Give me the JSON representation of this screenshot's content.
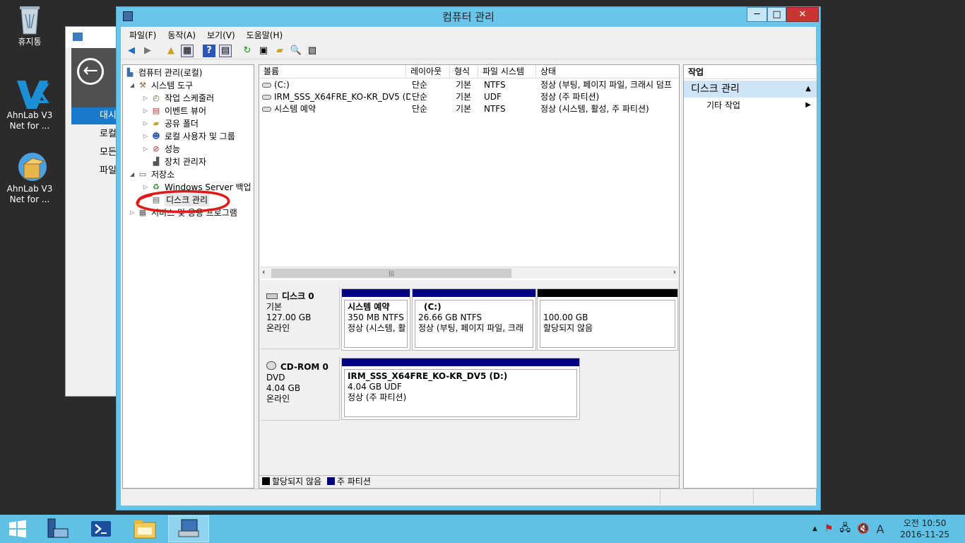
{
  "desktop": {
    "icons": [
      {
        "label": "휴지통"
      },
      {
        "label": "AhnLab V3 Net for ..."
      },
      {
        "label": "AhnLab V3 Net for ..."
      }
    ]
  },
  "background_window": {
    "nav": [
      "대시",
      "로컬",
      "모든",
      "파일"
    ]
  },
  "window": {
    "title": "컴퓨터 관리",
    "controls": {
      "minimize": "─",
      "maximize": "□",
      "close": "✕"
    },
    "menu": [
      "파일(F)",
      "동작(A)",
      "보기(V)",
      "도움말(H)"
    ]
  },
  "tree": [
    {
      "label": "컴퓨터 관리(로컬)",
      "icon": "computer-mgmt-icon"
    },
    {
      "label": "시스템 도구",
      "icon": "tools-icon"
    },
    {
      "label": "작업 스케줄러",
      "icon": "clock-icon"
    },
    {
      "label": "이벤트 뷰어",
      "icon": "event-viewer-icon"
    },
    {
      "label": "공유 폴더",
      "icon": "shared-folder-icon"
    },
    {
      "label": "로컬 사용자 및 그룹",
      "icon": "users-icon"
    },
    {
      "label": "성능",
      "icon": "performance-icon"
    },
    {
      "label": "장치 관리자",
      "icon": "device-manager-icon"
    },
    {
      "label": "저장소",
      "icon": "storage-icon"
    },
    {
      "label": "Windows Server 백업",
      "icon": "backup-icon"
    },
    {
      "label": "디스크 관리",
      "icon": "disk-mgmt-icon"
    },
    {
      "label": "서비스 및 응용 프로그램",
      "icon": "services-icon"
    }
  ],
  "volume_list": {
    "columns": [
      "볼륨",
      "레이아웃",
      "형식",
      "파일 시스템",
      "상태"
    ],
    "rows": [
      [
        "(C:)",
        "단순",
        "기본",
        "NTFS",
        "정상 (부팅, 페이지 파일, 크래시 덤프"
      ],
      [
        "IRM_SSS_X64FRE_KO-KR_DV5 (D:)",
        "단순",
        "기본",
        "UDF",
        "정상 (주 파티션)"
      ],
      [
        "시스템 예약",
        "단순",
        "기본",
        "NTFS",
        "정상 (시스템, 활성, 주 파티션)"
      ]
    ]
  },
  "disks": [
    {
      "name": "디스크 0",
      "type": "기본",
      "size": "127.00 GB",
      "status": "온라인",
      "partitions": [
        {
          "title": "시스템 예약",
          "line2": "350 MB NTFS",
          "line3": "정상 (시스템, 활",
          "color": "#000080"
        },
        {
          "title": "(C:)",
          "line2": "26.66 GB NTFS",
          "line3": "정상 (부팅, 페이지 파일, 크래",
          "color": "#000080"
        },
        {
          "title": "",
          "line2": "100.00 GB",
          "line3": "할당되지 않음",
          "color": "#000000"
        }
      ]
    },
    {
      "name": "CD-ROM 0",
      "type": "DVD",
      "size": "4.04 GB",
      "status": "온라인",
      "partitions": [
        {
          "title": "IRM_SSS_X64FRE_KO-KR_DV5  (D:)",
          "line2": "4.04 GB UDF",
          "line3": "정상 (주 파티션)",
          "color": "#000080"
        }
      ]
    }
  ],
  "legend": {
    "unallocated": "할당되지 않음",
    "primary": "주 파티션"
  },
  "actions": {
    "header": "작업",
    "section": "디스크 관리",
    "more": "기타 작업"
  },
  "taskbar": {
    "clock_time": "오전 10:50",
    "clock_date": "2016-11-25",
    "ime": "A"
  },
  "colors": {
    "accent": "#68c5e9",
    "taskbar": "#5fc1e5",
    "primary_partition": "#000080",
    "unallocated": "#000000"
  }
}
